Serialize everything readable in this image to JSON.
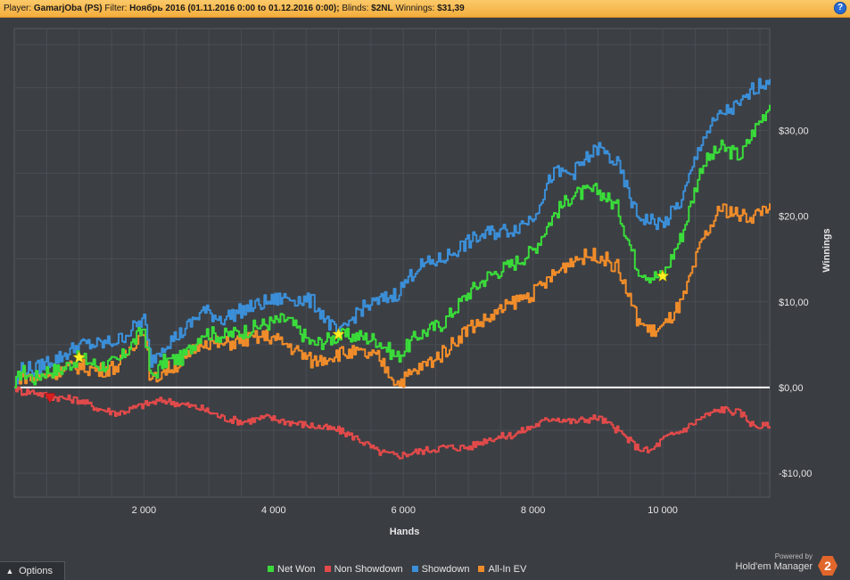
{
  "header": {
    "player_label": "Player:",
    "player_value": "GamarjOba (PS)",
    "filter_label": "Filter:",
    "filter_value": "Ноябрь 2016 (01.11.2016 0:00 to 01.12.2016 0:00);",
    "blinds_label": "Blinds:",
    "blinds_value": "$2NL",
    "winnings_label": "Winnings:",
    "winnings_value": "$31,39",
    "help_icon": "?"
  },
  "footer": {
    "options_label": "Options",
    "powered_by": "Powered by",
    "brand_name": "Hold'em Manager",
    "brand_logo": "2"
  },
  "colors": {
    "net_won": "#3adb3a",
    "non_showdown": "#e24a4a",
    "showdown": "#3b8fd8",
    "allin_ev": "#f08c2a",
    "header": "#f4ad3c",
    "background": "#3a3d42",
    "grid": "#4a4e54",
    "zero_line": "#ffffff"
  },
  "chart_data": {
    "type": "line",
    "xlabel": "Hands",
    "ylabel": "Winnings",
    "x_ticks": [
      2000,
      4000,
      6000,
      8000,
      10000
    ],
    "x_tick_labels": [
      "2 000",
      "4 000",
      "6 000",
      "8 000",
      "10 000"
    ],
    "y_ticks": [
      -10,
      0,
      10,
      20,
      30
    ],
    "y_tick_labels": [
      "-$10,00",
      "$0,00",
      "$10,00",
      "$20,00",
      "$30,00"
    ],
    "xlim": [
      0,
      11650
    ],
    "ylim": [
      -12.8,
      41.9
    ],
    "grid": true,
    "legend_position": "bottom",
    "x": [
      0,
      100,
      300,
      500,
      700,
      1000,
      1300,
      1600,
      2000,
      2100,
      2300,
      2600,
      2900,
      3200,
      3500,
      3900,
      4200,
      4600,
      5000,
      5300,
      5600,
      5900,
      6200,
      6600,
      7000,
      7300,
      7700,
      8000,
      8300,
      8600,
      9000,
      9300,
      9600,
      9800,
      10000,
      10300,
      10600,
      10900,
      11200,
      11400,
      11650
    ],
    "series": [
      {
        "name": "Net Won",
        "values": [
          0,
          2,
          1,
          2,
          2,
          3.5,
          2.5,
          3,
          7,
          1,
          3,
          3.5,
          6.5,
          6,
          6.5,
          7.5,
          8,
          5,
          6,
          6,
          5.5,
          3.5,
          6,
          7.5,
          11,
          13,
          14.5,
          16,
          20,
          22.5,
          23,
          21,
          14,
          13,
          13,
          18,
          26,
          28,
          27,
          30,
          33
        ]
      },
      {
        "name": "Non Showdown",
        "values": [
          0,
          -0.5,
          -0.5,
          -1,
          -1.2,
          -1.5,
          -2.5,
          -3,
          -2,
          -1.8,
          -1.5,
          -2,
          -2.5,
          -3.5,
          -4,
          -3.5,
          -4,
          -4.5,
          -5,
          -6,
          -7.5,
          -8,
          -7.5,
          -7,
          -7,
          -6,
          -5.5,
          -4.5,
          -3.5,
          -4,
          -3.5,
          -5,
          -7,
          -7.5,
          -6,
          -5,
          -3.5,
          -2.5,
          -3,
          -4.5,
          -4.5
        ]
      },
      {
        "name": "Showdown",
        "values": [
          0,
          2.5,
          2,
          3,
          3.5,
          5,
          5,
          5.5,
          8,
          3,
          5,
          6.5,
          9,
          8,
          9,
          10,
          10.5,
          10,
          6,
          9,
          10,
          11,
          14,
          15,
          17,
          18,
          18.5,
          20,
          25,
          25,
          28,
          26,
          20,
          19.5,
          19,
          22,
          29,
          32,
          33,
          35,
          36
        ]
      },
      {
        "name": "All-In EV",
        "values": [
          0,
          1.5,
          1,
          1.5,
          2,
          2.5,
          2,
          2.5,
          7,
          0.5,
          2,
          3,
          5.5,
          5,
          5.5,
          6,
          5,
          3,
          4,
          4,
          3.5,
          0.5,
          2,
          4,
          7,
          8,
          10,
          11,
          13,
          15,
          15.5,
          14,
          8,
          6.5,
          7,
          10,
          17,
          21,
          20,
          20,
          21.5
        ]
      }
    ]
  },
  "markers": [
    {
      "type": "star",
      "x": 1000,
      "y": 3.5
    },
    {
      "type": "star",
      "x": 5000,
      "y": 6.2
    },
    {
      "type": "star",
      "x": 10000,
      "y": 13
    },
    {
      "type": "triangle-down",
      "x": 550,
      "y": -1.2
    }
  ]
}
